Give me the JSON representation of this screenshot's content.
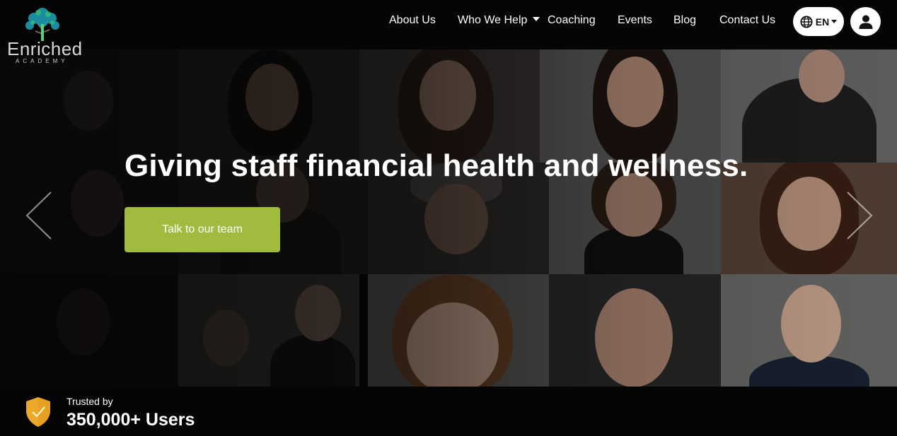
{
  "brand": {
    "name": "Enriched",
    "tagline": "ACADEMY"
  },
  "nav": {
    "items": [
      {
        "label": "About Us",
        "has_dropdown": false
      },
      {
        "label": "Who We Help",
        "has_dropdown": true
      },
      {
        "label": "Coaching",
        "has_dropdown": false
      },
      {
        "label": "Events",
        "has_dropdown": false
      },
      {
        "label": "Blog",
        "has_dropdown": false
      },
      {
        "label": "Contact Us",
        "has_dropdown": false
      }
    ],
    "language": "EN",
    "language_icon": "globe-icon",
    "account_icon": "user-icon"
  },
  "hero": {
    "headline": "Giving staff financial health and wellness.",
    "cta_label": "Talk to our team",
    "prev_icon": "chevron-left-icon",
    "next_icon": "chevron-right-icon"
  },
  "trust": {
    "label": "Trusted by",
    "count": "350,000+ Users",
    "icon": "shield-check-icon"
  },
  "colors": {
    "accent": "#a0bb3e",
    "shield": "#e8a020",
    "background": "#050505"
  }
}
